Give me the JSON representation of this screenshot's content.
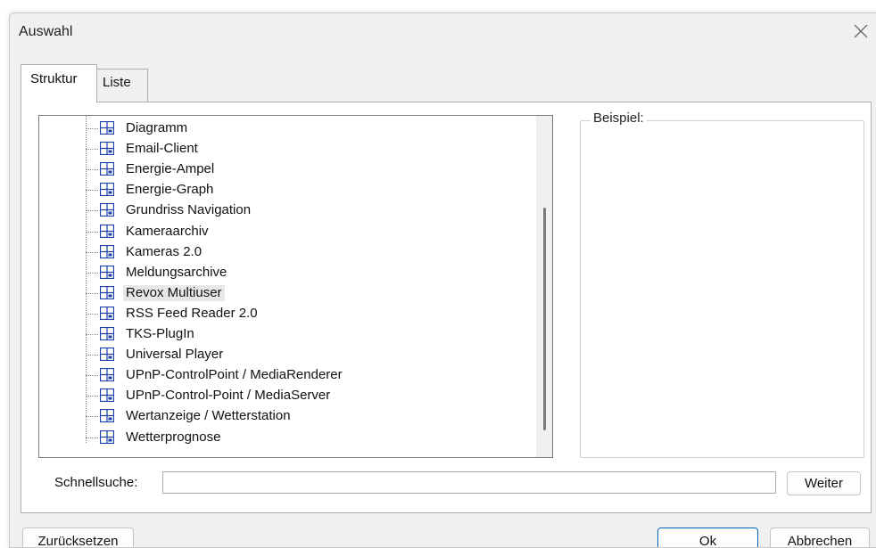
{
  "window": {
    "title": "Auswahl"
  },
  "tabs": [
    {
      "label": "Struktur",
      "active": true
    },
    {
      "label": "Liste",
      "active": false
    }
  ],
  "tree": {
    "items": [
      {
        "label": "Diagramm",
        "icon": "plugin-grid-icon"
      },
      {
        "label": "Email-Client",
        "icon": "plugin-grid-icon"
      },
      {
        "label": "Energie-Ampel",
        "icon": "plugin-grid-icon"
      },
      {
        "label": "Energie-Graph",
        "icon": "plugin-grid-icon"
      },
      {
        "label": "Grundriss Navigation",
        "icon": "plugin-grid-icon"
      },
      {
        "label": "Kameraarchiv",
        "icon": "plugin-grid-icon"
      },
      {
        "label": "Kameras 2.0",
        "icon": "plugin-grid-icon"
      },
      {
        "label": "Meldungsarchive",
        "icon": "plugin-grid-icon"
      },
      {
        "label": "Revox Multiuser",
        "icon": "plugin-grid-icon",
        "hover": true
      },
      {
        "label": "RSS Feed Reader 2.0",
        "icon": "plugin-grid-icon"
      },
      {
        "label": "TKS-PlugIn",
        "icon": "plugin-grid-icon"
      },
      {
        "label": "Universal Player",
        "icon": "plugin-grid-icon"
      },
      {
        "label": "UPnP-ControlPoint / MediaRenderer",
        "icon": "plugin-grid-icon"
      },
      {
        "label": "UPnP-Control-Point / MediaServer",
        "icon": "plugin-grid-icon"
      },
      {
        "label": "Wertanzeige / Wetterstation",
        "icon": "plugin-grid-icon"
      },
      {
        "label": "Wetterprognose",
        "icon": "plugin-grid-icon"
      }
    ]
  },
  "example": {
    "label": "Beispiel:"
  },
  "search": {
    "label": "Schnellsuche:",
    "value": "",
    "next_label": "Weiter"
  },
  "buttons": {
    "reset": "Zurücksetzen",
    "ok": "Ok",
    "cancel": "Abbrechen"
  },
  "colors": {
    "icon_blue": "#1f3fa8",
    "ok_border": "#0067c0",
    "dialog_bg": "#f0f0f0"
  }
}
